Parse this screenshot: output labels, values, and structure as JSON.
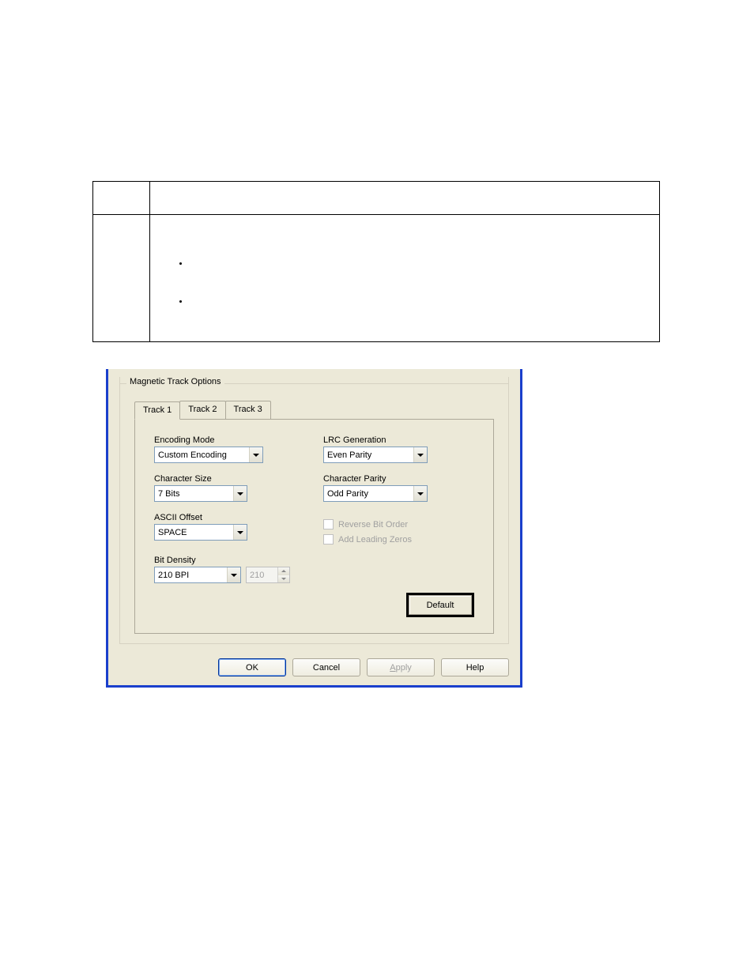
{
  "groupbox": {
    "title": "Magnetic Track Options"
  },
  "tabs": [
    "Track 1",
    "Track 2",
    "Track 3"
  ],
  "active_tab_index": 0,
  "tab1": {
    "encoding_mode": {
      "label": "Encoding Mode",
      "value": "Custom Encoding"
    },
    "character_size": {
      "label": "Character Size",
      "value": "7 Bits"
    },
    "ascii_offset": {
      "label": "ASCII Offset",
      "value": "SPACE"
    },
    "bit_density": {
      "label": "Bit Density",
      "value": "210 BPI",
      "spinner_value": "210"
    },
    "lrc_generation": {
      "label": "LRC Generation",
      "value": "Even Parity"
    },
    "character_parity": {
      "label": "Character Parity",
      "value": "Odd Parity"
    },
    "reverse_bit_order": {
      "label": "Reverse Bit Order",
      "checked": false
    },
    "add_leading_zeros": {
      "label": "Add Leading Zeros",
      "checked": false
    },
    "default_button": "Default"
  },
  "buttons": {
    "ok": "OK",
    "cancel": "Cancel",
    "apply_first": "A",
    "apply_rest": "pply",
    "help": "Help"
  }
}
